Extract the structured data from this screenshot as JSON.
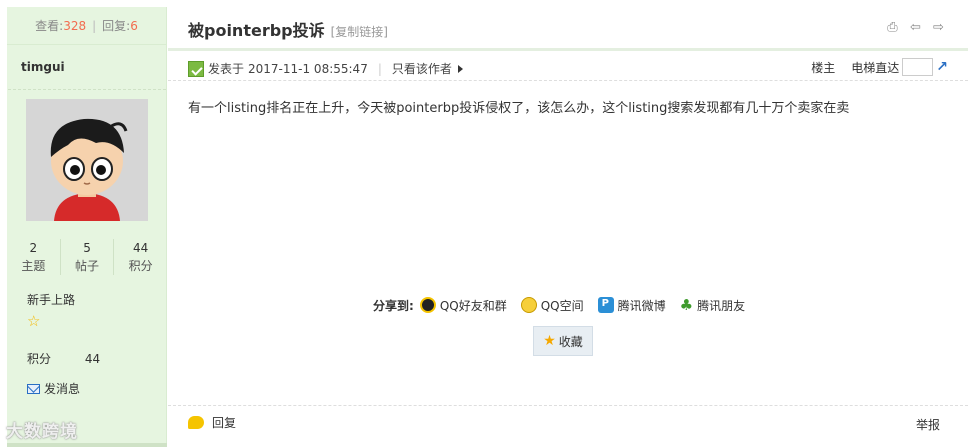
{
  "stats": {
    "views_label": "查看:",
    "views": "328",
    "replies_label": "回复:",
    "replies": "6"
  },
  "author": {
    "username": "timgui",
    "counts": [
      {
        "value": "2",
        "label": "主题"
      },
      {
        "value": "5",
        "label": "帖子"
      },
      {
        "value": "44",
        "label": "积分"
      }
    ],
    "rank": "新手上路",
    "credit_label": "积分",
    "credit_value": "44",
    "send_message": "发消息"
  },
  "thread": {
    "title": "被pointerbp投诉",
    "copy_link": "[复制链接]"
  },
  "post": {
    "posted_label": "发表于",
    "posted_time": "2017-11-1 08:55:47",
    "only_author": "只看该作者",
    "floor_label": "楼主",
    "jump_label": "电梯直达",
    "content": "有一个listing排名正在上升，今天被pointerbp投诉侵权了，该怎么办，这个listing搜索发现都有几十万个卖家在卖"
  },
  "share": {
    "label": "分享到:",
    "items": [
      {
        "name": "QQ好友和群",
        "icon": "qq-icon"
      },
      {
        "name": "QQ空间",
        "icon": "qzone-icon"
      },
      {
        "name": "腾讯微博",
        "icon": "tencent-weibo-icon"
      },
      {
        "name": "腾讯朋友",
        "icon": "clover-icon"
      }
    ],
    "favorite": "收藏"
  },
  "actions": {
    "reply": "回复",
    "report": "举报"
  },
  "watermark": "大数跨境",
  "colors": {
    "sidebar_bg": "#e6f5e0",
    "accent_number": "#f26c4f",
    "link_blue": "#2a6fc4"
  }
}
